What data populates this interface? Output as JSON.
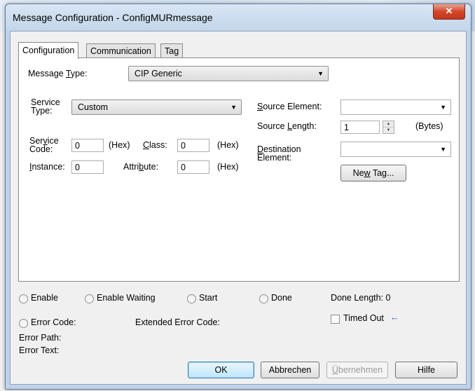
{
  "window": {
    "title": "Message Configuration - ConfigMURmessage",
    "close_glyph": "✕"
  },
  "tabs": [
    {
      "label": "Configuration",
      "active": true
    },
    {
      "label": "Communication",
      "active": false
    },
    {
      "label": "Tag",
      "active": false
    }
  ],
  "config": {
    "message_type": {
      "label_pre": "Message ",
      "label_ul": "T",
      "label_post": "ype:",
      "value": "CIP Generic"
    },
    "service_type": {
      "label_line1": "Service",
      "label_line2": "Type:",
      "value": "Custom"
    },
    "service_code": {
      "label_line1_pre": "Ser",
      "label_line1_ul": "v",
      "label_line1_post": "ice",
      "label_line2": "Code:",
      "value": "0",
      "unit": "(Hex)"
    },
    "class": {
      "label_ul": "C",
      "label_post": "lass:",
      "value": "0",
      "unit": "(Hex)"
    },
    "instance": {
      "label_ul": "I",
      "label_post": "nstance:",
      "value": "0"
    },
    "attribute": {
      "label_pre": "Attri",
      "label_ul": "b",
      "label_post": "ute:",
      "value": "0",
      "unit": "(Hex)"
    },
    "source_element": {
      "label_ul": "S",
      "label_post": "ource Element:",
      "value": ""
    },
    "source_length": {
      "label_pre": "Source ",
      "label_ul": "L",
      "label_post": "ength:",
      "value": "1",
      "unit": "(Bytes)"
    },
    "destination_element": {
      "label_line1_ul": "D",
      "label_line1_post": "estination",
      "label_line2": "Element:",
      "value": ""
    },
    "new_tag_button": {
      "pre": "Ne",
      "ul": "w",
      "post": " Tag..."
    }
  },
  "status": {
    "enable": "Enable",
    "enable_waiting": "Enable Waiting",
    "start": "Start",
    "done": "Done",
    "done_length": "Done Length: 0",
    "error_code": "Error Code:",
    "extended_error_code": "Extended Error Code:",
    "timed_out": "Timed Out",
    "timed_out_arrow": "←",
    "error_path": "Error Path:",
    "error_text": "Error Text:"
  },
  "buttons": {
    "ok": "OK",
    "cancel": "Abbrechen",
    "apply_ul": "Ü",
    "apply_post": "bernehmen",
    "help": "Hilfe"
  },
  "colors": {
    "accent_blue": "#3c7fb1",
    "close_red": "#c2361c"
  }
}
